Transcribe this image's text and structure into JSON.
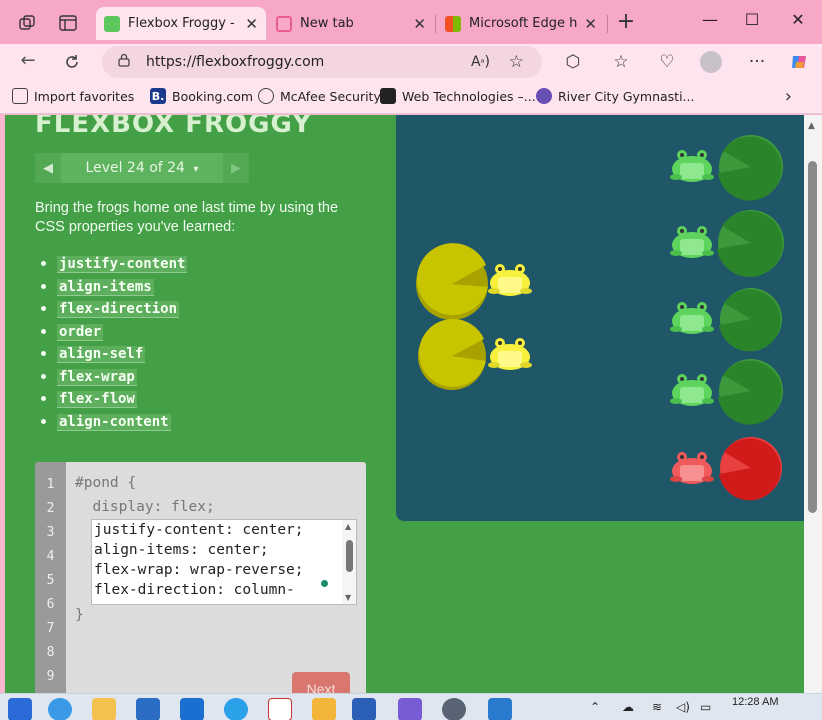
{
  "browser": {
    "tabs": [
      {
        "title": "Flexbox Froggy - A g",
        "favicon_color": "#5cc85c",
        "active": true
      },
      {
        "title": "New tab",
        "favicon_color": "#e85d8a",
        "active": false
      },
      {
        "title": "Microsoft Edge help",
        "favicon_color": "#e8704a",
        "active": false
      }
    ],
    "new_tab_symbol": "+",
    "window_controls": {
      "minimize": "—",
      "maximize": "☐",
      "close": "✕"
    },
    "url": "https://flexboxfroggy.com",
    "read_aloud": "Aͅ",
    "favorites": [
      {
        "label": "Import favorites",
        "icon": "import-icon",
        "icon_color": "#444444",
        "glyph": ""
      },
      {
        "label": "Booking.com",
        "icon": "booking-icon",
        "icon_color": "#1a3b8c",
        "glyph": "B."
      },
      {
        "label": "McAfee Security",
        "icon": "globe-icon",
        "icon_color": "#444444",
        "glyph": ""
      },
      {
        "label": "Web Technologies –...",
        "icon": "book-icon",
        "icon_color": "#222222",
        "glyph": ""
      },
      {
        "label": "River City Gymnasti...",
        "icon": "gym-icon",
        "icon_color": "#6a4fb3",
        "glyph": ""
      }
    ]
  },
  "game": {
    "logo": "FLEXBOX FROGGY",
    "level_label": "Level 24 of 24",
    "level_dropdown": "▾",
    "instructions": "Bring the frogs home one last time by using the CSS properties you've learned:",
    "properties": [
      "justify-content",
      "align-items",
      "flex-direction",
      "order",
      "align-self",
      "flex-wrap",
      "flex-flow",
      "align-content"
    ],
    "line_numbers": [
      "1",
      "2",
      "3",
      "4",
      "5",
      "6",
      "7",
      "8",
      "9"
    ],
    "code_open": "#pond {",
    "code_fixed": "  display: flex;",
    "code_close": "}",
    "user_code": [
      "justify-content: center;",
      "align-items: center;",
      "flex-wrap: wrap-reverse;",
      "flex-direction: column-"
    ],
    "next_label": "Next",
    "lilypads": [
      {
        "color": "yellow",
        "side": "left",
        "index": 0
      },
      {
        "color": "yellow",
        "side": "left",
        "index": 1
      },
      {
        "color": "green",
        "side": "right",
        "index": 0
      },
      {
        "color": "green",
        "side": "right",
        "index": 1
      },
      {
        "color": "green",
        "side": "right",
        "index": 2
      },
      {
        "color": "green",
        "side": "right",
        "index": 3
      },
      {
        "color": "red",
        "side": "right",
        "index": 4
      }
    ],
    "frogs": [
      {
        "color": "yellow"
      },
      {
        "color": "yellow"
      },
      {
        "color": "green"
      },
      {
        "color": "green"
      },
      {
        "color": "green"
      },
      {
        "color": "green"
      },
      {
        "color": "red"
      }
    ],
    "colors": {
      "pond": "#1f5768",
      "page": "#43a047",
      "yellow_pad": "#c8c400",
      "green_pad": "#2e8b2e",
      "red_pad": "#d81b1b"
    }
  },
  "taskbar": {
    "time": "12:28 AM"
  }
}
